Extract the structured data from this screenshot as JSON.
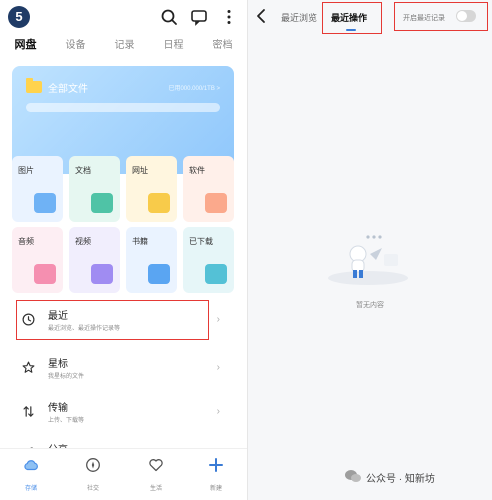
{
  "left": {
    "avatar": "5",
    "tabs": [
      "网盘",
      "设备",
      "记录",
      "日程",
      "密档"
    ],
    "files": {
      "title": "全部文件",
      "usage": "已用000.000/1TB >"
    },
    "categories": [
      "图片",
      "文档",
      "网址",
      "软件",
      "音频",
      "视频",
      "书籍",
      "已下载"
    ],
    "list": [
      {
        "title": "最近",
        "sub": "最近浏览、最近操作记录等"
      },
      {
        "title": "星标",
        "sub": "我星标的文件"
      },
      {
        "title": "传输",
        "sub": "上传、下载等"
      },
      {
        "title": "分享",
        "sub": ""
      }
    ],
    "nav": [
      "存储",
      "社交",
      "生活",
      "新建"
    ]
  },
  "right": {
    "tabs": [
      "最近浏览",
      "最近操作"
    ],
    "toggle_label": "开启最近记录",
    "empty": "暂无内容",
    "watermark": "公众号 · 知新坊"
  },
  "colors": {
    "accent": "#3a7bd5",
    "highlight": "#e53935",
    "card": "#9fd0fd"
  }
}
